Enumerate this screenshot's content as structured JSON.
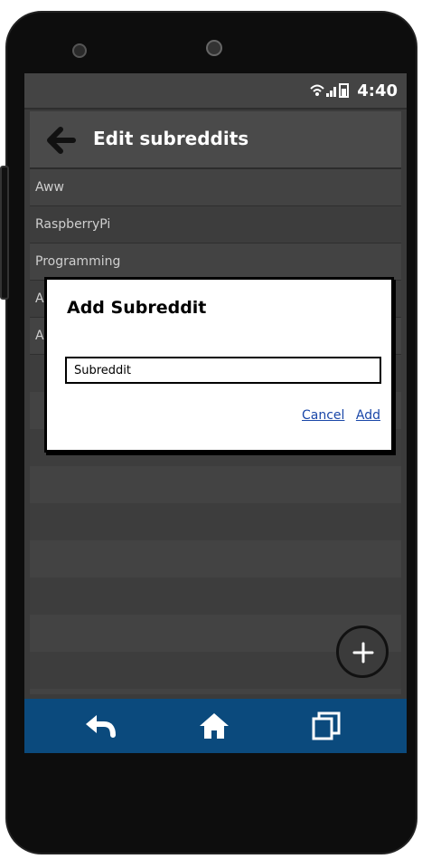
{
  "status_bar": {
    "icons": "wifi-signal-battery",
    "time": "4:40"
  },
  "app_bar": {
    "back_icon": "arrow-left-icon",
    "title": "Edit subreddits"
  },
  "subreddit_list": {
    "items": [
      {
        "label": "Aww"
      },
      {
        "label": "RaspberryPi"
      },
      {
        "label": "Programming"
      },
      {
        "label": "A"
      },
      {
        "label": "A"
      }
    ]
  },
  "dialog": {
    "title": "Add Subreddit",
    "input_placeholder": "Subreddit",
    "cancel_label": "Cancel",
    "add_label": "Add"
  },
  "fab": {
    "icon": "plus-icon"
  },
  "nav_bar": {
    "back_icon": "back-icon",
    "home_icon": "home-icon",
    "recent_icon": "recent-apps-icon",
    "color": "#0b4a7d"
  }
}
